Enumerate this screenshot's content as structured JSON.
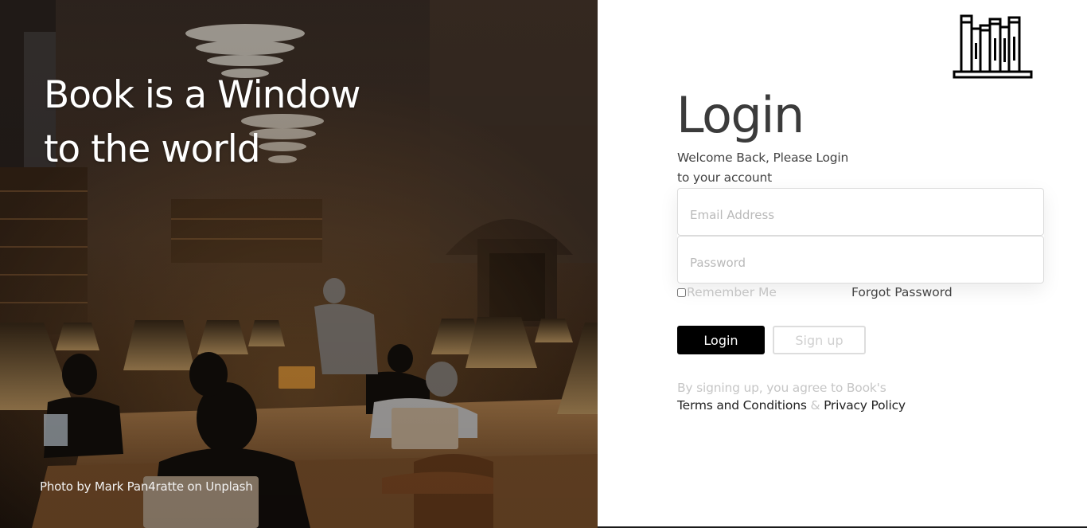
{
  "hero": {
    "tagline_line1": "Book is a Window",
    "tagline_line2": "to the world",
    "photo_credit": "Photo by Mark Pan4ratte on Unplash"
  },
  "logo": {
    "icon": "books-on-shelf-icon"
  },
  "login": {
    "title": "Login",
    "welcome_line1": "Welcome Back, Please Login",
    "welcome_line2": "to your account",
    "email_placeholder": "Email Address",
    "password_placeholder": "Password",
    "remember_label": "Remember Me",
    "forgot_label": "Forgot Password",
    "login_button": "Login",
    "signup_button": "Sign up",
    "terms_intro": "By signing up, you agree to Book's",
    "terms_link": "Terms and Conditions",
    "terms_amp": "&",
    "privacy_link": "Privacy Policy"
  },
  "colors": {
    "primary_button": "#000000",
    "text_dark": "#3b3b3b",
    "text_muted": "#c6c6c6"
  }
}
